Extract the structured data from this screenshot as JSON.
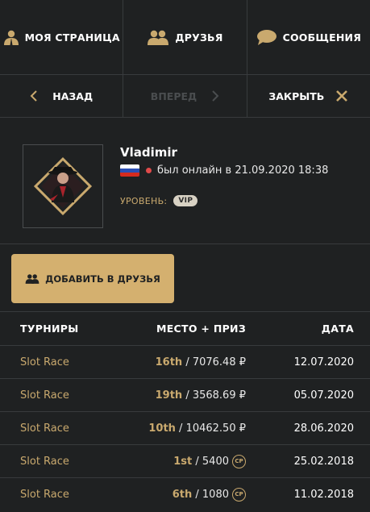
{
  "top_nav": {
    "my_page": "МОЯ СТРАНИЦА",
    "friends": "ДРУЗЬЯ",
    "messages": "СООБЩЕНИЯ"
  },
  "sub_nav": {
    "back": "НАЗАД",
    "forward": "ВПЕРЕД",
    "close": "ЗАКРЫТЬ"
  },
  "profile": {
    "username": "Vladimir",
    "status": "был онлайн в 21.09.2020 18:38",
    "level_label": "УРОВЕНЬ:",
    "level_badge": "VIP"
  },
  "add_friend_label": "ДОБАВИТЬ В ДРУЗЬЯ",
  "table": {
    "headers": [
      "ТУРНИРЫ",
      "МЕСТО + ПРИЗ",
      "ДАТА"
    ],
    "rows": [
      {
        "name": "Slot Race",
        "place": "16th",
        "prize": " / 7076.48 ₽",
        "cp": false,
        "date": "12.07.2020"
      },
      {
        "name": "Slot Race",
        "place": "19th",
        "prize": " / 3568.69 ₽",
        "cp": false,
        "date": "05.07.2020"
      },
      {
        "name": "Slot Race",
        "place": "10th",
        "prize": " / 10462.50 ₽",
        "cp": false,
        "date": "28.06.2020"
      },
      {
        "name": "Slot Race",
        "place": "1st",
        "prize": " / 5400",
        "cp": true,
        "date": "25.02.2018"
      },
      {
        "name": "Slot Race",
        "place": "6th",
        "prize": " / 1080",
        "cp": true,
        "date": "11.02.2018"
      }
    ],
    "cp_label": "CP"
  },
  "colors": {
    "background": "#1f2122",
    "gold": "#c9a96e",
    "button_gold": "#d4b06f",
    "online_dot": "#e04a4a"
  }
}
